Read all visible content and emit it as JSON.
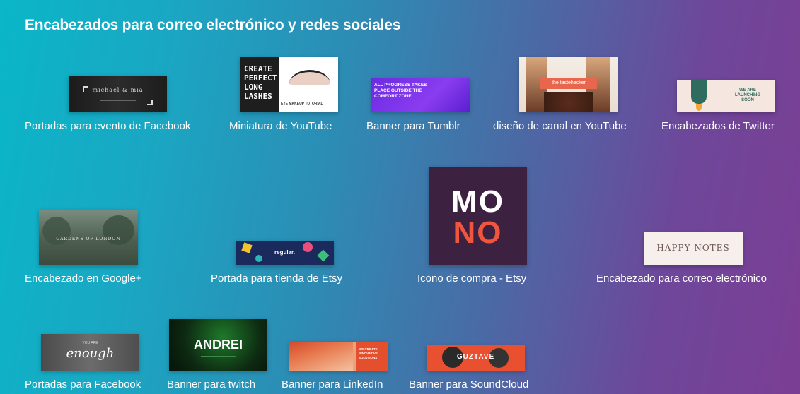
{
  "section": {
    "title": "Encabezados para correo electrónico y redes sociales"
  },
  "tiles": [
    {
      "caption": "Portadas para evento de Facebook",
      "thumb_text": "michael & mia"
    },
    {
      "caption": "Miniatura de YouTube",
      "thumb_text": "CREATE PERFECT LONG LASHES",
      "thumb_subtext": "EYE MAKEUP TUTORIAL"
    },
    {
      "caption": "Banner para Tumblr",
      "thumb_text": "ALL PROGRESS TAKES PLACE OUTSIDE THE COMFORT ZONE"
    },
    {
      "caption": "diseño de canal en YouTube",
      "thumb_text": "the tastehacker"
    },
    {
      "caption": "Encabezados de Twitter",
      "thumb_text": "WE ARE LAUNCHING SOON"
    },
    {
      "caption": "Encabezado en Google+",
      "thumb_text": "GARDENS OF LONDON"
    },
    {
      "caption": "Portada para tienda de Etsy",
      "thumb_text": "regular."
    },
    {
      "caption": "Icono de compra - Etsy",
      "thumb_text": "MO",
      "thumb_subtext": "NO"
    },
    {
      "caption": "Encabezado para correo electrónico",
      "thumb_text": "HAPPY NOTES"
    },
    {
      "caption": "Portadas para Facebook",
      "thumb_text": "enough",
      "thumb_subtext": "YOU ARE"
    },
    {
      "caption": "Banner para twitch",
      "thumb_text": "ANDREI"
    },
    {
      "caption": "Banner para LinkedIn",
      "thumb_text": "WE CREATE INNOVATIVE SOLUTIONS"
    },
    {
      "caption": "Banner para SoundCloud",
      "thumb_text": "GUZTAVE"
    }
  ]
}
